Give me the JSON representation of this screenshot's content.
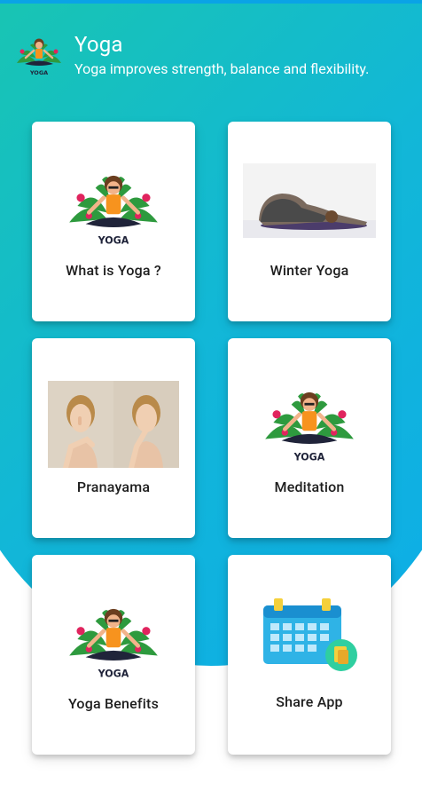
{
  "header": {
    "title": "Yoga",
    "subtitle": "Yoga improves strength, balance and flexibility."
  },
  "logo_text": "YOGA",
  "cards": [
    {
      "label": "What is Yoga ?",
      "icon": "yoga-logo-icon"
    },
    {
      "label": "Winter Yoga",
      "icon": "child-pose-photo"
    },
    {
      "label": "Pranayama",
      "icon": "breathing-exercise-photo"
    },
    {
      "label": "Meditation",
      "icon": "yoga-logo-icon"
    },
    {
      "label": "Yoga Benefits",
      "icon": "yoga-logo-icon"
    },
    {
      "label": "Share App",
      "icon": "calendar-icon"
    }
  ],
  "colors": {
    "gradient_start": "#1fd68a",
    "gradient_end": "#0dace9",
    "card_background": "#ffffff",
    "orange": "#f7931e",
    "leaf_green": "#2e9a3e"
  }
}
